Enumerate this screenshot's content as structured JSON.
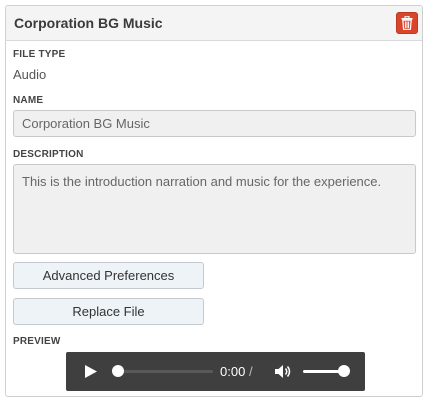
{
  "panel": {
    "title": "Corporation BG Music",
    "delete_icon": "trash-icon"
  },
  "file_type": {
    "label": "FILE TYPE",
    "value": "Audio"
  },
  "name": {
    "label": "NAME",
    "value": "Corporation BG Music"
  },
  "description": {
    "label": "DESCRIPTION",
    "value": "This is the introduction narration and music for the experience."
  },
  "buttons": {
    "advanced_preferences": "Advanced Preferences",
    "replace_file": "Replace File"
  },
  "preview": {
    "label": "PREVIEW",
    "player": {
      "current_time": "0:00",
      "separator": "/",
      "play_icon": "play-icon",
      "volume_icon": "volume-icon",
      "progress_fraction": 0,
      "volume_fraction": 0.85
    }
  },
  "colors": {
    "delete_button": "#d9442b",
    "player_background": "#3f3f3f"
  }
}
